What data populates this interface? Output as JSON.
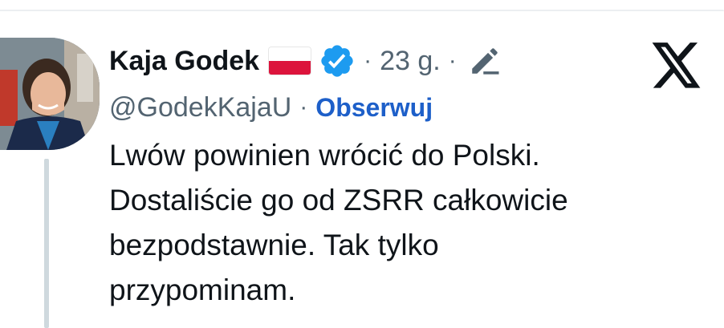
{
  "tweet": {
    "author": {
      "display_name": "Kaja Godek",
      "handle": "@GodekKajaU",
      "flag": "poland-flag-icon",
      "verified": true,
      "avatar_icon": "avatar"
    },
    "separator": "·",
    "time": "23 g.",
    "follow_label": "Obserwuj",
    "text_lines": [
      "Lwów powinien wrócić do Polski.",
      "Dostaliście go od ZSRR całkowicie",
      "bezpodstawnie. Tak tylko",
      "przypominam."
    ]
  },
  "colors": {
    "verified_blue": "#1d9bf0",
    "link_blue": "#1d5fc9",
    "secondary_text": "#536471",
    "flag_red": "#dc143c"
  }
}
